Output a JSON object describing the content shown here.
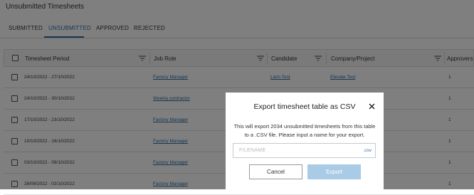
{
  "page": {
    "title": "Unsubmitted Timesheets"
  },
  "tabs": [
    {
      "label": "SUBMITTED"
    },
    {
      "label": "UNSUBMITTED"
    },
    {
      "label": "APPROVED"
    },
    {
      "label": "REJECTED"
    }
  ],
  "active_tab": "UNSUBMITTED",
  "table": {
    "columns": [
      {
        "label": "Timesheet Period"
      },
      {
        "label": "Job Role"
      },
      {
        "label": "Candidate"
      },
      {
        "label": "Company/Project"
      },
      {
        "label": "Approvers"
      }
    ],
    "rows": [
      {
        "period": "24/10/2022 - 27/10/2022",
        "job_role": "Factory Manager",
        "candidate": "Liam Test",
        "company": "Elevate Test",
        "approvers": "1"
      },
      {
        "period": "24/10/2022 - 30/10/2022",
        "job_role": "Weekly contractor",
        "candidate": "",
        "company": "",
        "approvers": "1"
      },
      {
        "period": "17/10/2022 - 23/10/2022",
        "job_role": "Factory Manager",
        "candidate": "",
        "company": "",
        "approvers": "1"
      },
      {
        "period": "10/10/2022 - 16/10/2022",
        "job_role": "Factory Manager",
        "candidate": "",
        "company": "",
        "approvers": "1"
      },
      {
        "period": "03/10/2022 - 09/10/2022",
        "job_role": "Factory Manager",
        "candidate": "",
        "company": "",
        "approvers": "1"
      },
      {
        "period": "26/09/2022 - 02/10/2022",
        "job_role": "Factory Manager",
        "candidate": "",
        "company": "",
        "approvers": "1"
      }
    ]
  },
  "modal": {
    "title": "Export timesheet table as CSV",
    "description": "This will export 2034 unsubmitted timesheets from this table to a .CSV file. Please input a name for your export.",
    "filename": {
      "placeholder": "FILENAME",
      "value": "",
      "extension": ".csv"
    },
    "cancel_label": "Cancel",
    "export_label": "Export"
  },
  "colors": {
    "accent": "#2f6fa8",
    "export_disabled": "#a9cbe6",
    "overlay": "rgba(0,0,0,0.5)"
  },
  "icons": [
    "filter-icon",
    "checkbox",
    "close-icon"
  ]
}
